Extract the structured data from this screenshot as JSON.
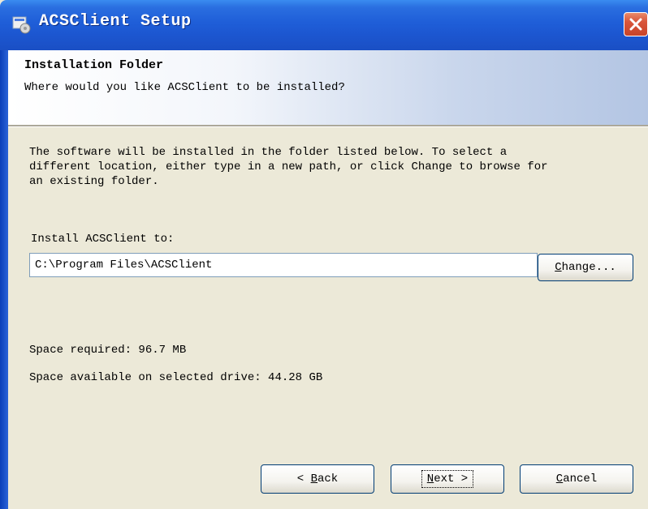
{
  "window": {
    "title": "ACSClient Setup"
  },
  "banner": {
    "title": "Installation Folder",
    "subtitle": "Where would you like ACSClient to be installed?"
  },
  "body": {
    "description": "The software will be installed in the folder listed below. To select a\ndifferent location, either type in a new path, or click Change to browse for\nan existing folder.",
    "install_label": "Install ACSClient to:",
    "install_path": "C:\\Program Files\\ACSClient",
    "change_label_mnemonic": "C",
    "change_label_rest": "hange...",
    "space_required": "Space required: 96.7 MB",
    "space_available": "Space available on selected drive: 44.28 GB"
  },
  "buttons": {
    "back_prefix": "< ",
    "back_mnemonic": "B",
    "back_rest": "ack",
    "next_mnemonic": "N",
    "next_rest": "ext >",
    "cancel_mnemonic": "C",
    "cancel_rest": "ancel"
  },
  "icons": {
    "app_icon": "installer-icon",
    "close_icon": "close-icon"
  },
  "colors": {
    "titlebar": "#1f5ed8",
    "dialog_bg": "#ece9d8",
    "close_button": "#d8553a"
  }
}
